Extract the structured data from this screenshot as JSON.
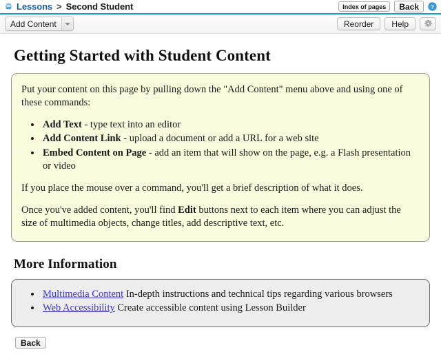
{
  "breadcrumb": {
    "icon": "lessons-icon",
    "root_label": "Lessons",
    "separator": ">",
    "current_label": "Second Student",
    "index_button": "Index of pages",
    "back_button": "Back",
    "help_icon": "help-circle-icon"
  },
  "toolbar": {
    "add_content_label": "Add Content",
    "dropdown_icon": "chevron-down-icon",
    "reorder_label": "Reorder",
    "help_label": "Help",
    "settings_icon": "gear-icon"
  },
  "main": {
    "page_title": "Getting Started with Student Content",
    "intro": {
      "paragraph": "Put your content on this page by pulling down the \"Add Content\" menu above and using one of these commands:",
      "commands": [
        {
          "name": "Add Text",
          "dash": " - ",
          "description": "type text into an editor"
        },
        {
          "name": "Add Content Link",
          "dash": " - ",
          "description": "upload a document or add a URL for a web site"
        },
        {
          "name": "Embed Content on Page",
          "dash": " - ",
          "description": "add an item that will show on the page, e.g. a Flash presentation or video"
        }
      ],
      "hover_hint": "If you place the mouse over a command, you'll get a brief description of what it does.",
      "edit_note_before": "Once you've added content, you'll find ",
      "edit_note_bold": "Edit",
      "edit_note_after": " buttons next to each item where you can adjust the size of multimedia objects, change titles, add descriptive text, etc."
    },
    "more_information": {
      "section_title": "More Information",
      "links": [
        {
          "link_text": "Multimedia Content",
          "description": " In-depth instructions and technical tips regarding various browsers"
        },
        {
          "link_text": "Web Accessibility",
          "description": " Create accessible content using Lesson Builder"
        }
      ]
    }
  },
  "footer": {
    "back_button": "Back"
  },
  "colors": {
    "accent_rule": "#0b9bd6",
    "link_blue": "#1a5ea8",
    "panel_yellow_bg": "#fbfbdd",
    "panel_grey_bg": "#ededed",
    "body_link": "#3d35c9"
  }
}
